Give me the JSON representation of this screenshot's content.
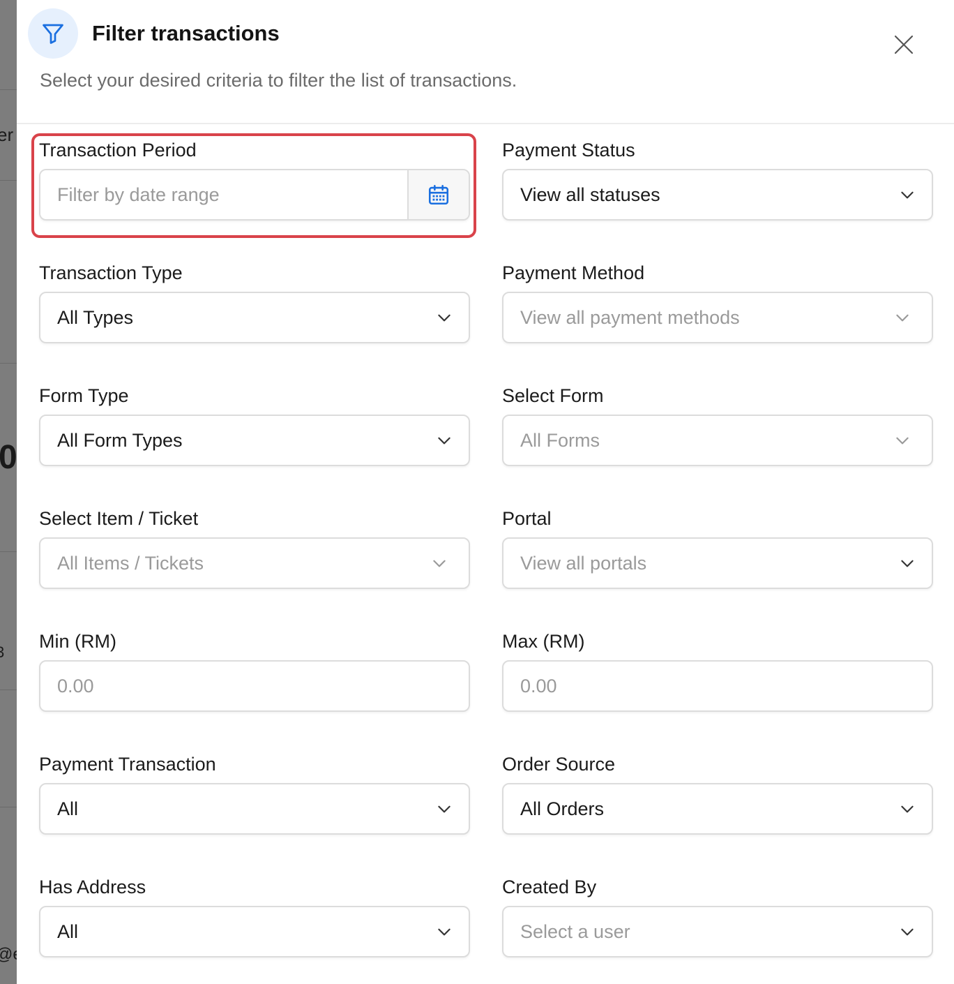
{
  "backdrop": {
    "peek_top": "er",
    "peek_mid": "0",
    "peek_badge": "3",
    "peek_bottom": "@e"
  },
  "modal": {
    "title": "Filter transactions",
    "subtitle": "Select your desired criteria to filter the list of transactions.",
    "close_icon": "close-icon",
    "header_icon": "filter-icon"
  },
  "fields": {
    "transaction_period": {
      "label": "Transaction Period",
      "placeholder": "Filter by date range",
      "icon": "calendar-icon"
    },
    "payment_status": {
      "label": "Payment Status",
      "value": "View all statuses"
    },
    "transaction_type": {
      "label": "Transaction Type",
      "value": "All Types"
    },
    "payment_method": {
      "label": "Payment Method",
      "placeholder": "View all payment methods"
    },
    "form_type": {
      "label": "Form Type",
      "value": "All Form Types"
    },
    "select_form": {
      "label": "Select Form",
      "placeholder": "All Forms"
    },
    "select_item": {
      "label": "Select Item / Ticket",
      "placeholder": "All Items / Tickets"
    },
    "portal": {
      "label": "Portal",
      "placeholder": "View all portals"
    },
    "min_rm": {
      "label": "Min (RM)",
      "placeholder": "0.00"
    },
    "max_rm": {
      "label": "Max (RM)",
      "placeholder": "0.00"
    },
    "payment_transaction": {
      "label": "Payment Transaction",
      "value": "All"
    },
    "order_source": {
      "label": "Order Source",
      "value": "All Orders"
    },
    "has_address": {
      "label": "Has Address",
      "value": "All"
    },
    "created_by": {
      "label": "Created By",
      "placeholder": "Select a user"
    }
  },
  "colors": {
    "accent": "#1a6fe0",
    "highlight": "#d9434a",
    "icon_bg": "#e6f0fd"
  }
}
